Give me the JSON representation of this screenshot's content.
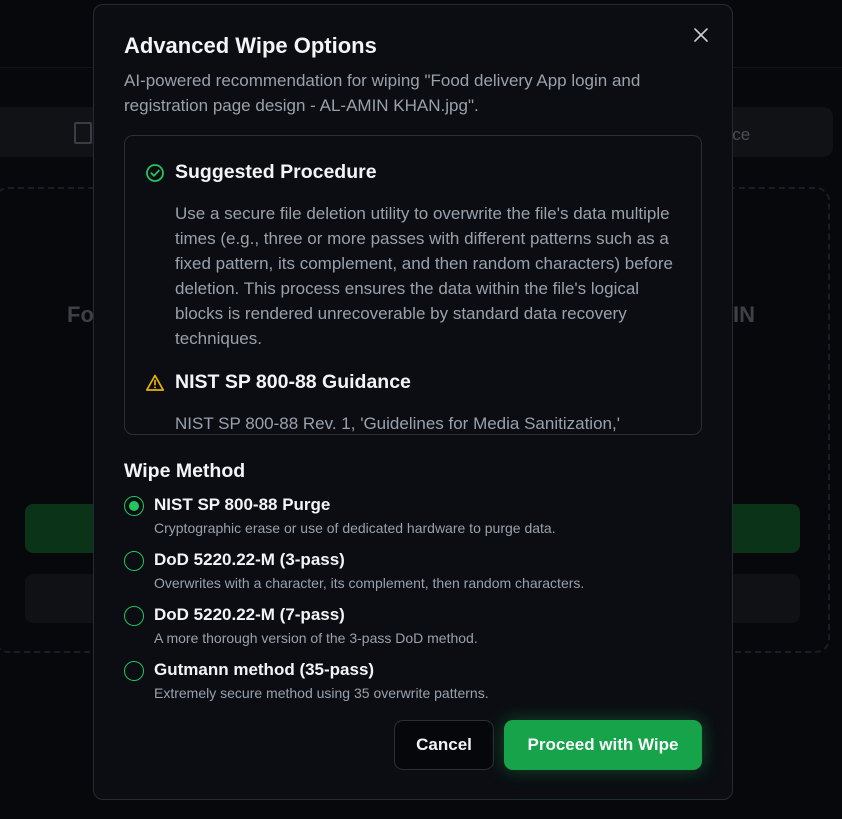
{
  "background": {
    "tab_partial_text": "vice",
    "title_left_partial": "Fo",
    "title_right_partial": "IN"
  },
  "modal": {
    "title": "Advanced Wipe Options",
    "description": "AI-powered recommendation for wiping \"Food delivery App login and registration page design - AL-AMIN KHAN.jpg\".",
    "close_icon": "close-icon"
  },
  "recommendation": {
    "procedure": {
      "icon": "check-circle-icon",
      "heading": "Suggested Procedure",
      "body": "Use a secure file deletion utility to overwrite the file's data multiple times (e.g., three or more passes with different patterns such as a fixed pattern, its complement, and then random characters) before deletion. This process ensures the data within the file's logical blocks is rendered unrecoverable by standard data recovery techniques."
    },
    "guidance": {
      "icon": "warning-triangle-icon",
      "heading": "NIST SP 800-88 Guidance",
      "body": "NIST SP 800-88 Rev. 1, 'Guidelines for Media Sanitization,'"
    }
  },
  "wipe_method": {
    "title": "Wipe Method",
    "selected_index": 0,
    "options": [
      {
        "label": "NIST SP 800-88 Purge",
        "description": "Cryptographic erase or use of dedicated hardware to purge data."
      },
      {
        "label": "DoD 5220.22-M (3-pass)",
        "description": "Overwrites with a character, its complement, then random characters."
      },
      {
        "label": "DoD 5220.22-M (7-pass)",
        "description": "A more thorough version of the 3-pass DoD method."
      },
      {
        "label": "Gutmann method (35-pass)",
        "description": "Extremely secure method using 35 overwrite patterns."
      }
    ]
  },
  "actions": {
    "cancel_label": "Cancel",
    "proceed_label": "Proceed with Wipe"
  },
  "colors": {
    "accent_green": "#16a34a",
    "radio_green": "#22c55e",
    "warning_amber": "#eab308",
    "modal_bg": "#0b0d12"
  }
}
